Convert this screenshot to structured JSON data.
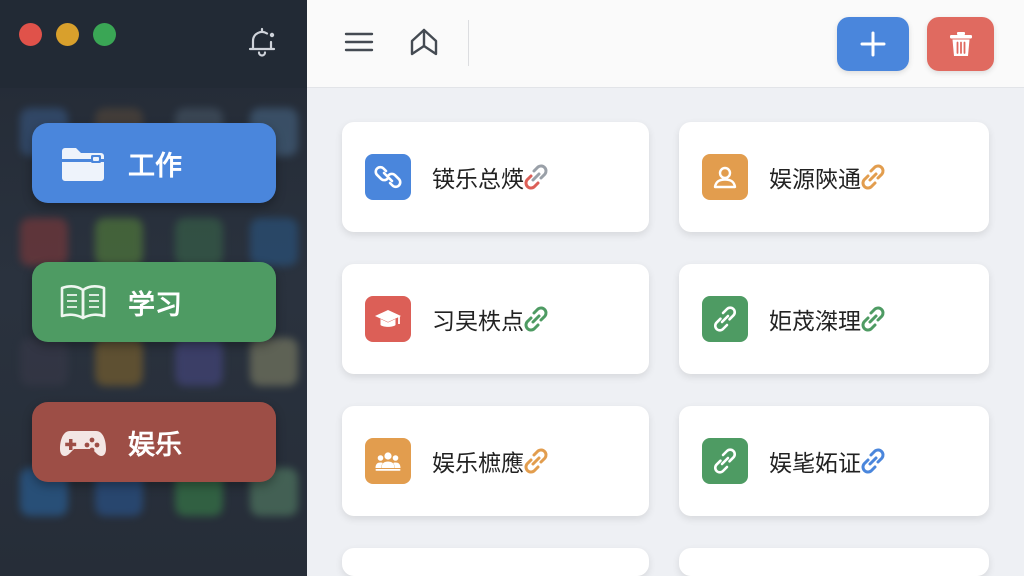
{
  "window": {
    "controls": [
      "close",
      "minimize",
      "maximize"
    ],
    "colors": {
      "close": "#e0524a",
      "minimize": "#d9a02c",
      "maximize": "#3aa655"
    }
  },
  "sidebar": {
    "notification_icon": "bell-icon",
    "categories": [
      {
        "label": "工作",
        "icon": "folder-icon",
        "color": "#4a86dc"
      },
      {
        "label": "学习",
        "icon": "book-icon",
        "color": "#4e9b63"
      },
      {
        "label": "娱乐",
        "icon": "gamepad-icon",
        "color": "#9d4e46"
      }
    ]
  },
  "toolbar": {
    "menu_icon": "hamburger-menu-icon",
    "tag_icon": "bookmark-tag-icon",
    "add_icon": "plus-icon",
    "delete_icon": "trash-icon",
    "add_color": "#4a86dc",
    "delete_color": "#e06a60"
  },
  "cards": [
    {
      "label": "锳乐总煐",
      "icon": "link-icon",
      "color": "#4a86dc"
    },
    {
      "label": "娱源陝通",
      "icon": "user-icon",
      "color": "#e29d4e"
    },
    {
      "label": "习旲柣点",
      "icon": "graduation-cap-icon",
      "color": "#dc5f57"
    },
    {
      "label": "姖荗滐理",
      "icon": "link-icon",
      "color": "#4e9b63"
    },
    {
      "label": "娱乐樜應",
      "icon": "group-icon",
      "color": "#e29d4e"
    },
    {
      "label": "娱毞妬证",
      "icon": "link-icon",
      "color": "#4e9b63"
    }
  ]
}
